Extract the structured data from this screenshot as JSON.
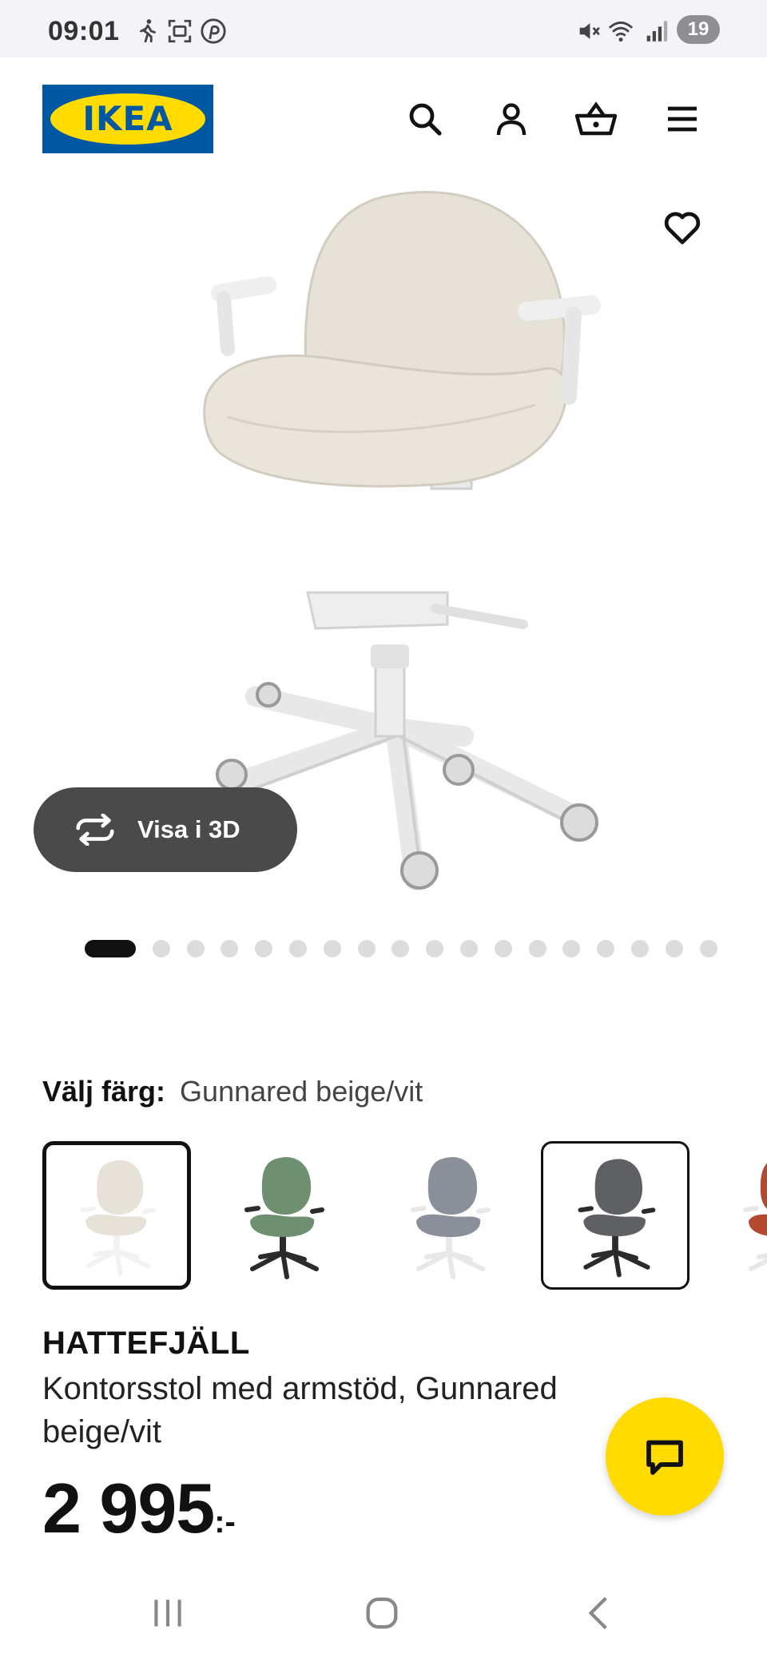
{
  "status_bar": {
    "time": "09:01",
    "battery_level": "19",
    "icons": [
      "walking-icon",
      "screenshot-icon",
      "pinterest-icon",
      "mute-icon",
      "wifi-icon",
      "signal-icon",
      "battery-icon"
    ]
  },
  "header": {
    "logo_text": "IKEA",
    "icons": [
      "search-icon",
      "account-icon",
      "cart-icon",
      "menu-icon"
    ],
    "brand_blue": "#0058a3",
    "brand_yellow": "#ffdb00"
  },
  "gallery": {
    "view_3d_label": "Visa i 3D",
    "image_count": 18,
    "active_index": 0
  },
  "color_picker": {
    "label": "Välj färg:",
    "value": "Gunnared beige/vit",
    "swatches": [
      {
        "name": "beige-white",
        "seat": "#e6e2d7",
        "base": "#f2f2f2",
        "selected": true
      },
      {
        "name": "green-black",
        "seat": "#6f8f71",
        "base": "#2b2b2b",
        "selected": false
      },
      {
        "name": "grey-white",
        "seat": "#8a9099",
        "base": "#e8e8e8",
        "selected": false
      },
      {
        "name": "darkgrey-black",
        "seat": "#5e6064",
        "base": "#2b2b2b",
        "selected": false
      },
      {
        "name": "red-white",
        "seat": "#b5492f",
        "base": "#e8e8e8",
        "selected": false
      }
    ]
  },
  "product": {
    "name": "HATTEFJÄLL",
    "description": "Kontorsstol med armstöd, Gunnared beige/vit",
    "price": "2 995",
    "price_suffix": ":-"
  },
  "chat": {
    "icon": "chat-icon",
    "color": "#ffdb00"
  },
  "nav": {
    "icons": [
      "recent-apps-icon",
      "home-icon",
      "back-icon"
    ]
  }
}
